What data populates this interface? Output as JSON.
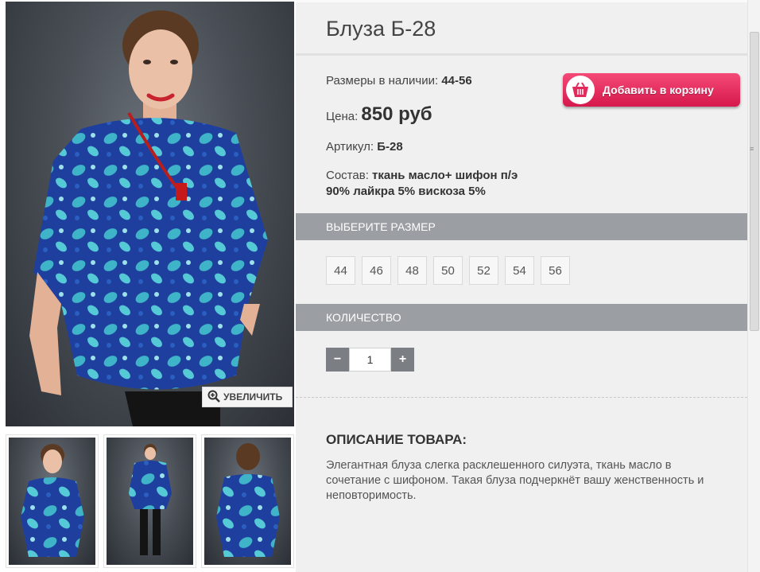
{
  "gallery": {
    "zoom_label": "УВЕЛИЧИТЬ"
  },
  "product": {
    "title": "Блуза Б-28",
    "sizes_label": "Размеры в наличии:",
    "sizes_value": "44-56",
    "price_label": "Цена:",
    "price_value": "850 руб",
    "sku_label": "Артикул:",
    "sku_value": "Б-28",
    "composition_label": "Состав:",
    "composition_value_line1": "ткань масло+ шифон п/э",
    "composition_value_line2": "90% лайкра 5% вискоза 5%",
    "cart_button": "Добавить в корзину"
  },
  "size_section": {
    "header": "ВЫБЕРИТЕ РАЗМЕР",
    "options": [
      "44",
      "46",
      "48",
      "50",
      "52",
      "54",
      "56"
    ]
  },
  "quantity_section": {
    "header": "КОЛИЧЕСТВО",
    "minus": "−",
    "value": "1",
    "plus": "+"
  },
  "description": {
    "title": "ОПИСАНИЕ ТОВАРА:",
    "text": "Элегантная блуза слегка расклешенного силуэта, ткань масло в сочетание с шифоном. Такая блуза подчеркнёт вашу женственность и неповторимость."
  },
  "colors": {
    "cart_button": "#e32a5c",
    "section_header": "#9b9ea2",
    "qty_button": "#7b7e83"
  },
  "icons": {
    "zoom": "zoom-in-icon",
    "cart": "basket-icon"
  }
}
